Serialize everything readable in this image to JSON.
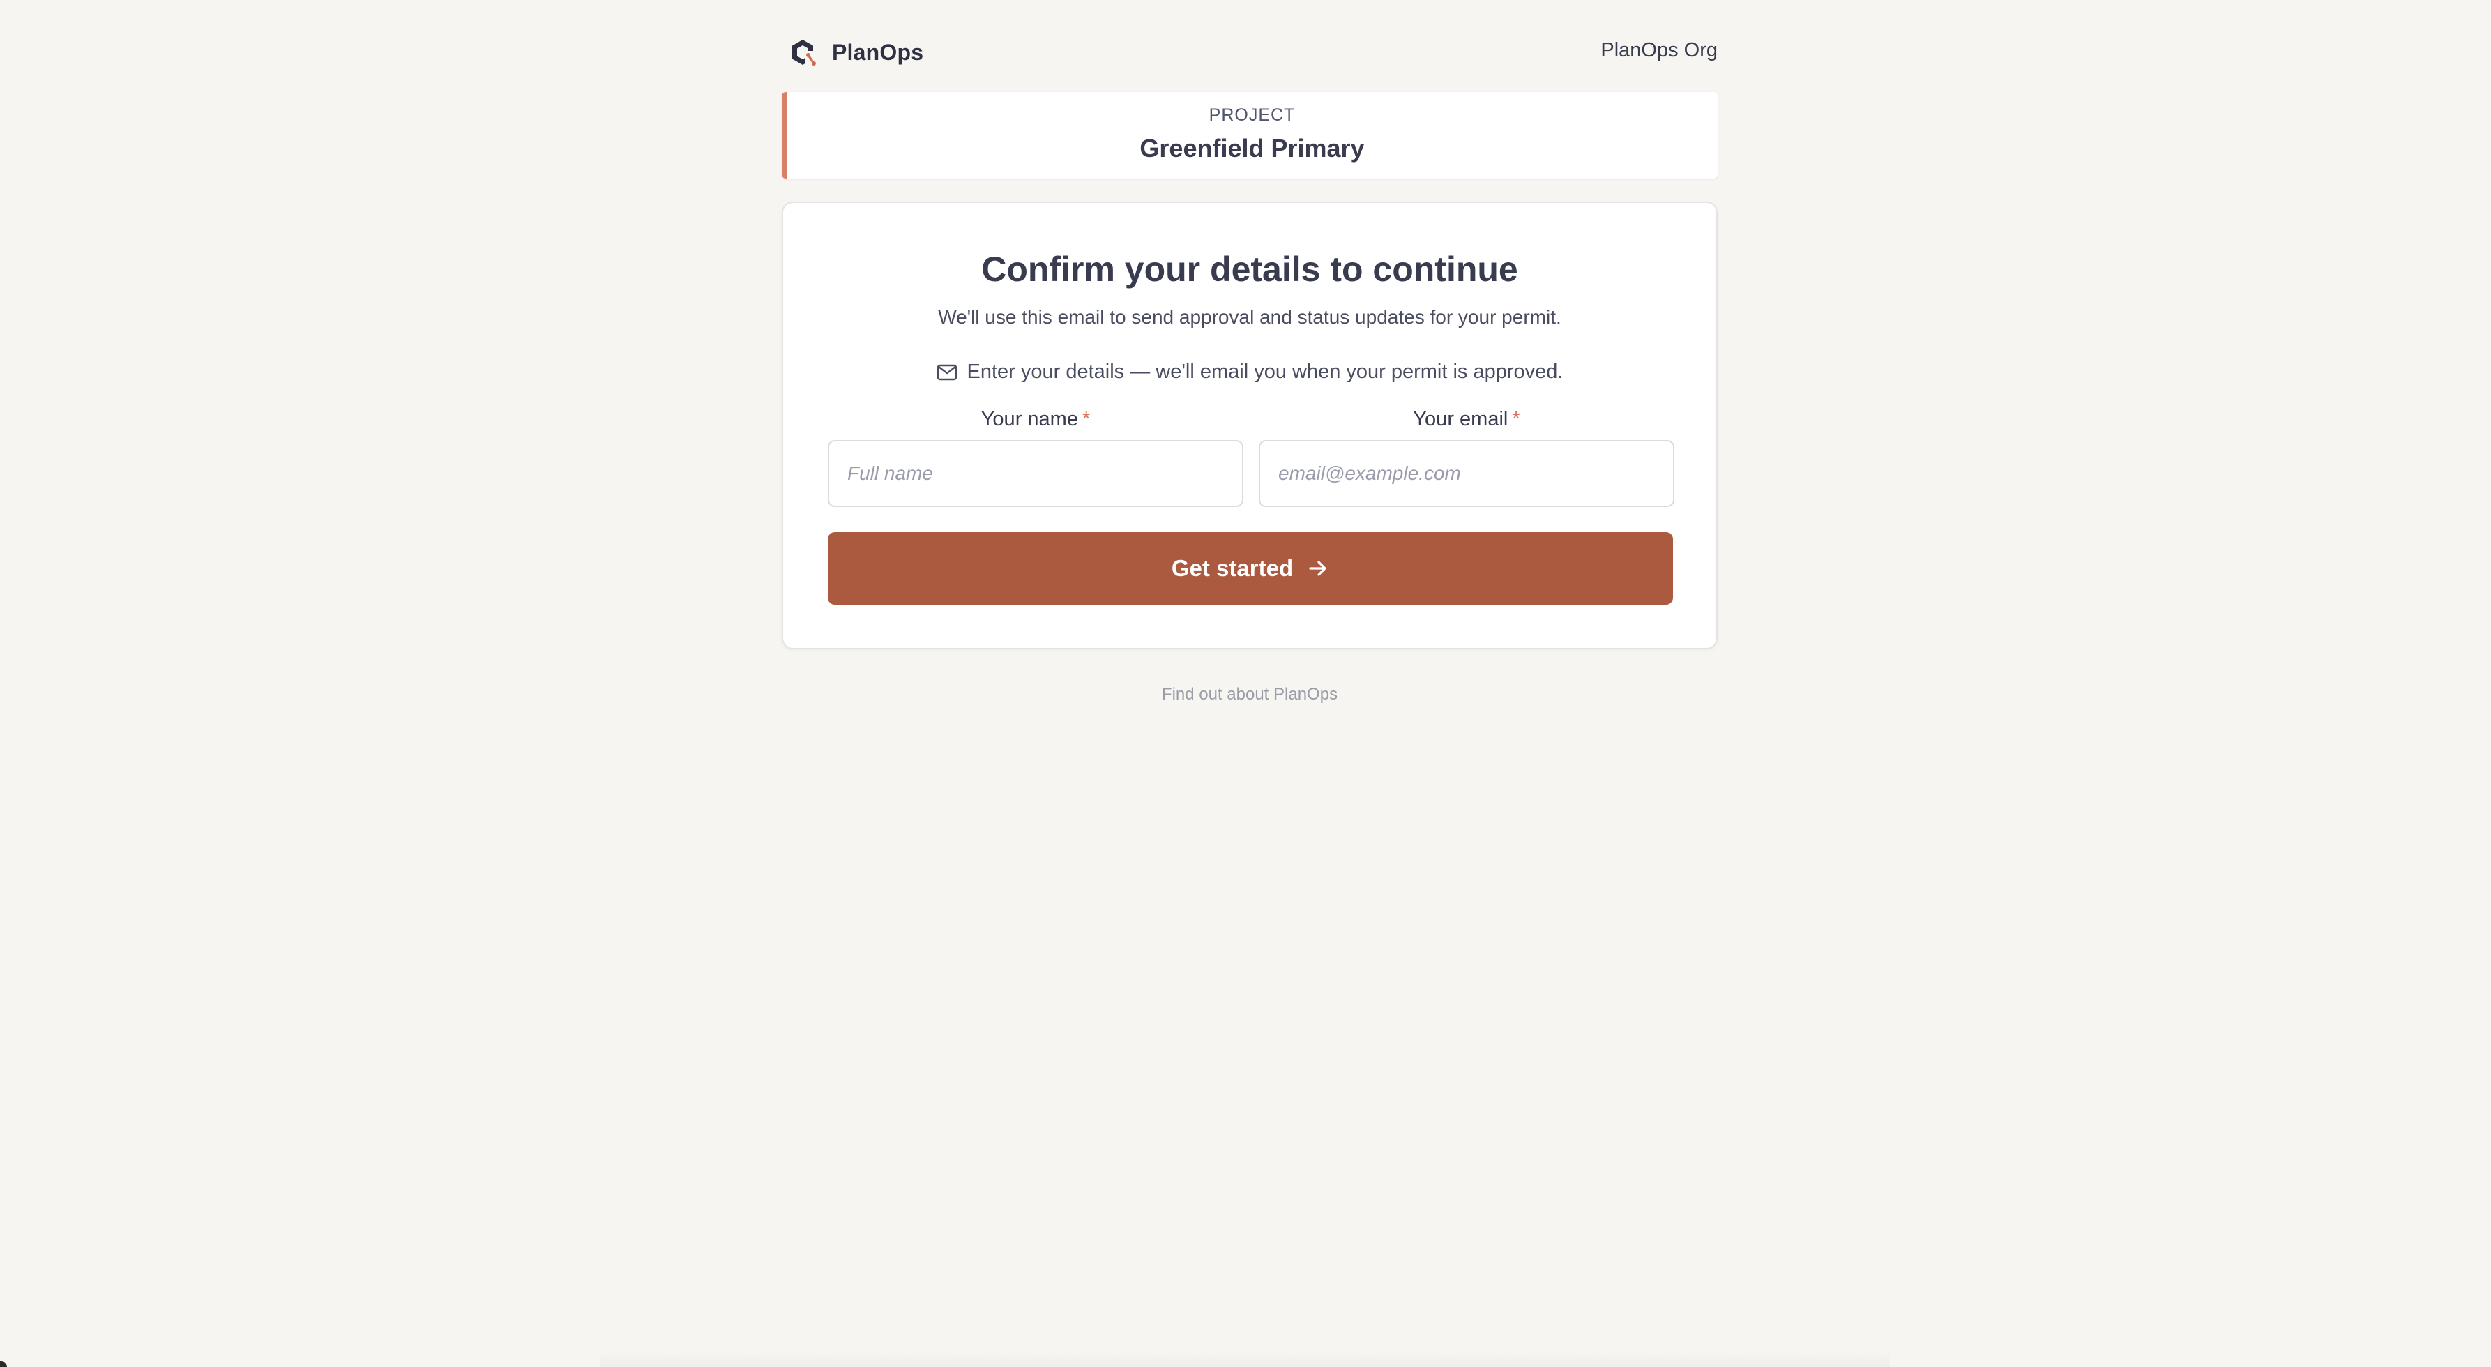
{
  "header": {
    "brand_name": "PlanOps",
    "logo_icon": "planops-logo-icon",
    "org_name": "PlanOps Org"
  },
  "project": {
    "label": "PROJECT",
    "name": "Greenfield Primary"
  },
  "form": {
    "title": "Confirm your details to continue",
    "subtitle": "We'll use this email to send approval and status updates for your permit.",
    "notice_icon": "mail-icon",
    "notice": "Enter your details — we'll email you when your permit is approved.",
    "name_field": {
      "label": "Your name",
      "required_mark": "*",
      "placeholder": "Full name",
      "value": ""
    },
    "email_field": {
      "label": "Your email",
      "required_mark": "*",
      "placeholder": "email@example.com",
      "value": ""
    },
    "submit": {
      "label": "Get started",
      "icon": "arrow-right-icon"
    }
  },
  "footer": {
    "link_text": "Find out about PlanOps"
  },
  "colors": {
    "background": "#f6f5f2",
    "accent": "#ab5a40",
    "project_border": "#d88068",
    "required": "#e0705a",
    "text": "#393b4f"
  }
}
